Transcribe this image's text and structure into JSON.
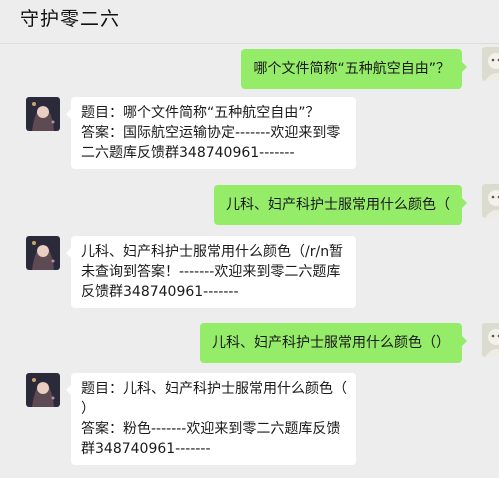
{
  "chat": {
    "title": "守护零二六"
  },
  "messages": [
    {
      "from": "user",
      "text": "哪个文件简称“五种航空自由”？"
    },
    {
      "from": "bot",
      "lines": [
        "题目：哪个文件简称“五种航空自由”？",
        "答案：国际航空运输协定-------欢迎来到零",
        "二六题库反馈群348740961-------"
      ]
    },
    {
      "from": "user",
      "text": "儿科、妇产科护士服常用什么颜色（"
    },
    {
      "from": "bot",
      "lines": [
        "儿科、妇产科护士服常用什么颜色（/r/n暂",
        "未查询到答案！-------欢迎来到零二六题库",
        "反馈群348740961-------"
      ]
    },
    {
      "from": "user",
      "text": "儿科、妇产科护士服常用什么颜色（）"
    },
    {
      "from": "bot",
      "lines": [
        "题目：儿科、妇产科护士服常用什么颜色（",
        "）",
        "答案：粉色-------欢迎来到零二六题库反馈",
        "群348740961-------"
      ]
    }
  ]
}
